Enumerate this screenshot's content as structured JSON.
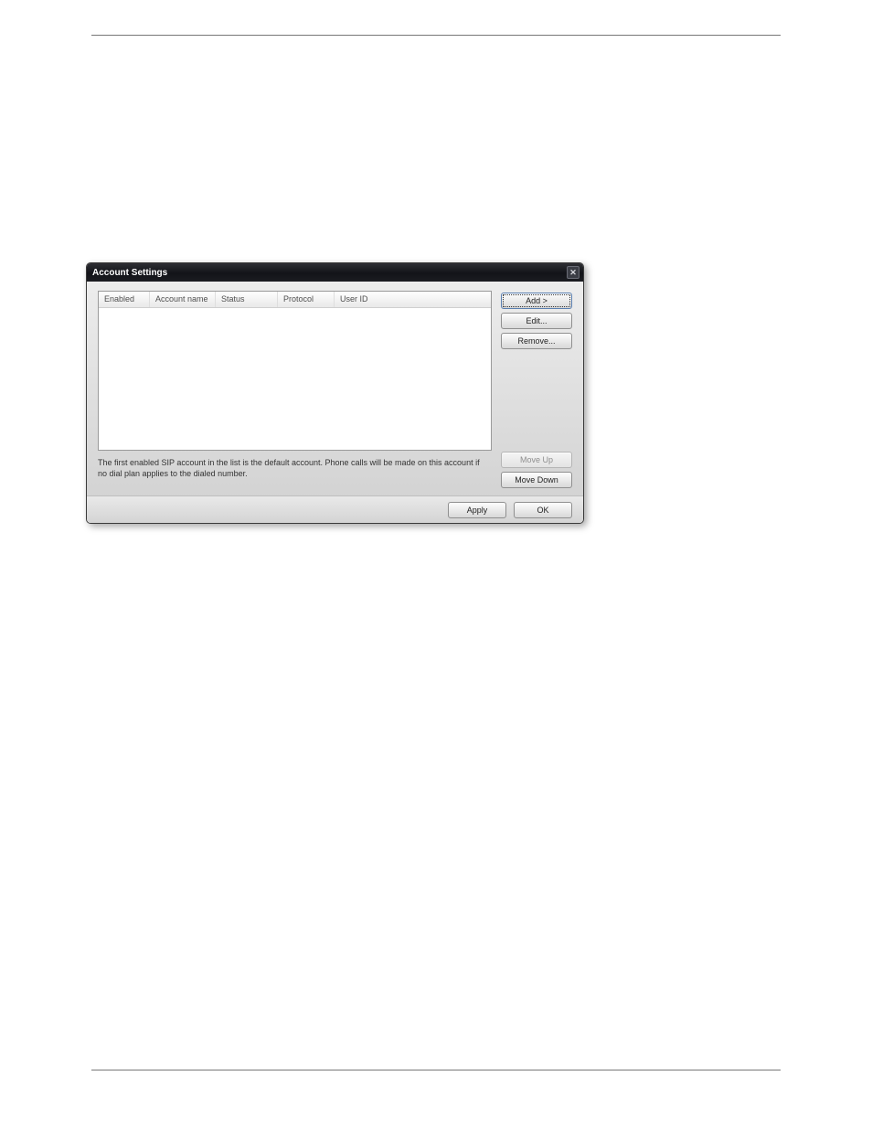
{
  "dialog": {
    "title": "Account Settings",
    "table": {
      "columns": {
        "enabled": "Enabled",
        "account_name": "Account name",
        "status": "Status",
        "protocol": "Protocol",
        "user_id": "User ID"
      }
    },
    "note_text": "The first enabled SIP account in the list is the default account. Phone calls will be made on this account if no dial plan applies to the dialed number.",
    "buttons": {
      "add": "Add >",
      "edit": "Edit...",
      "remove": "Remove...",
      "move_up": "Move Up",
      "move_down": "Move Down"
    },
    "footer": {
      "apply": "Apply",
      "ok": "OK"
    },
    "close_glyph": "✕"
  }
}
